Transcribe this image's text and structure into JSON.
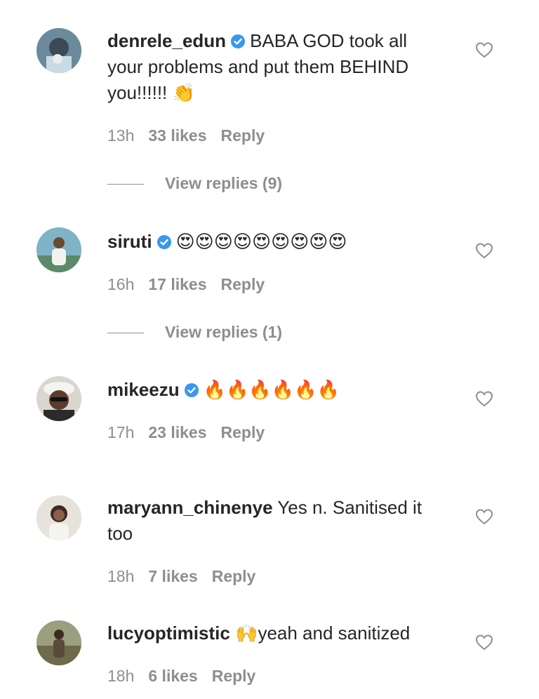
{
  "comments": [
    {
      "username": "denrele_edun",
      "verified": true,
      "text": "BABA GOD took all your problems and put them BEHIND you!!!!!! ",
      "emoji": "👏",
      "time": "13h",
      "likes": "33 likes",
      "reply": "Reply",
      "view_replies": "View replies (9)"
    },
    {
      "username": "siruti",
      "verified": true,
      "text": "",
      "emoji": "😍😍😍😍😍😍😍😍😍",
      "time": "16h",
      "likes": "17 likes",
      "reply": "Reply",
      "view_replies": "View replies (1)"
    },
    {
      "username": "mikeezu",
      "verified": true,
      "text": "",
      "emoji": "🔥🔥🔥🔥🔥🔥",
      "time": "17h",
      "likes": "23 likes",
      "reply": "Reply"
    },
    {
      "username": "maryann_chinenye",
      "verified": false,
      "text": "Yes n. Sanitised it too",
      "time": "18h",
      "likes": "7 likes",
      "reply": "Reply"
    },
    {
      "username": "lucyoptimistic",
      "verified": false,
      "emoji": "🙌",
      "text": "yeah and sanitized",
      "time": "18h",
      "likes": "6 likes",
      "reply": "Reply"
    }
  ],
  "colors": {
    "text": "#262626",
    "muted": "#8e8e8e",
    "verified_blue": "#3897f0",
    "background": "#ffffff"
  },
  "icons": {
    "verified": "verified-badge-icon",
    "like": "heart-outline-icon"
  }
}
